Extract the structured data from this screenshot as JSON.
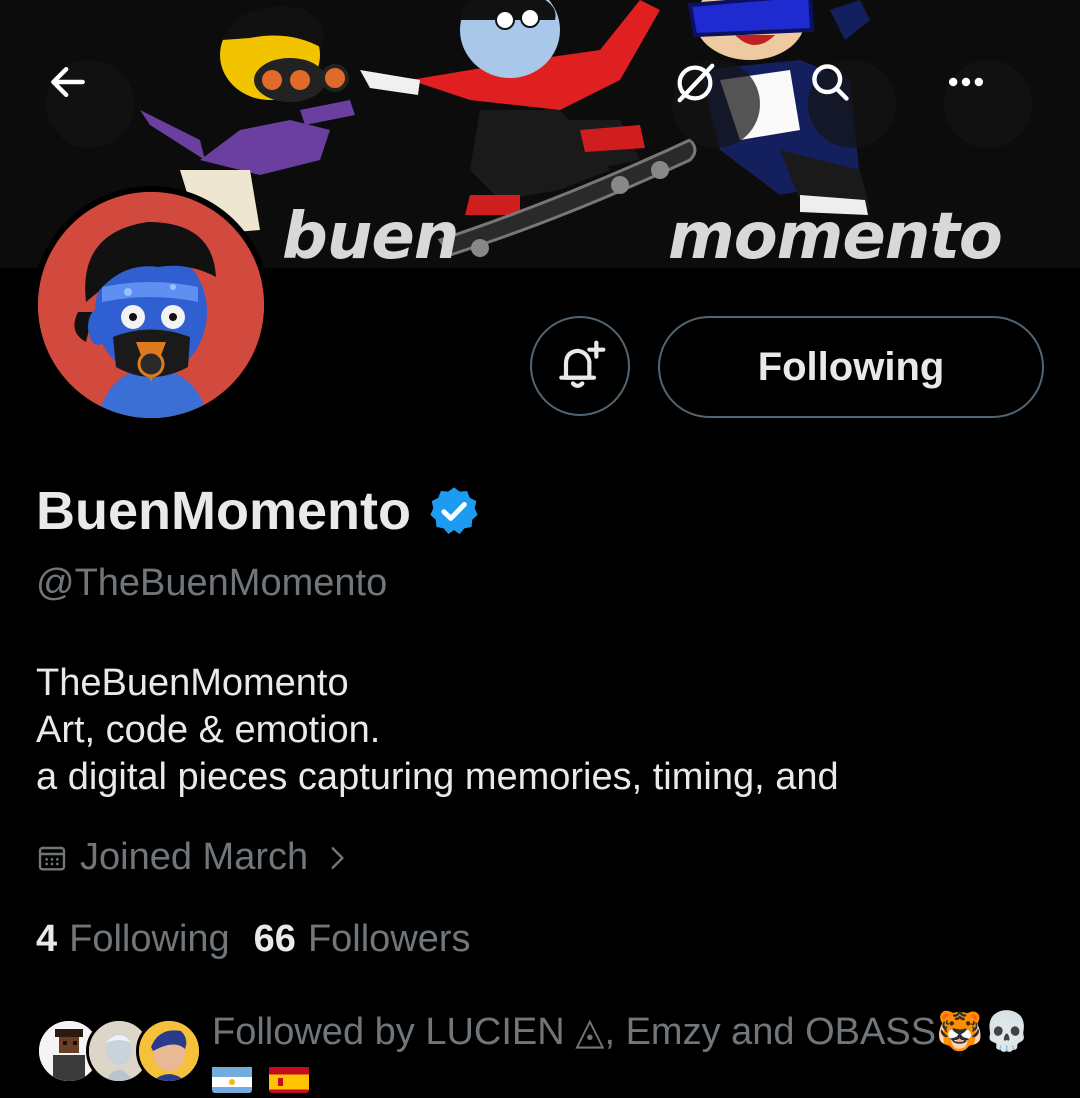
{
  "header": {
    "banner_words": [
      "buen",
      "momento"
    ],
    "buttons": {
      "back_icon": "arrow-left-icon",
      "grok_icon": "grok-icon",
      "search_icon": "search-icon",
      "more_icon": "more-icon"
    }
  },
  "profile": {
    "display_name": "BuenMomento",
    "verified": true,
    "handle": "@TheBuenMomento",
    "bio": [
      "TheBuenMomento",
      "Art, code & emotion.",
      "a digital pieces capturing memories, timing, and"
    ],
    "joined": "Joined March",
    "follow_button_label": "Following",
    "following_count": "4",
    "following_label": "Following",
    "followers_count": "66",
    "followers_label": "Followers",
    "followed_by_text": "Followed by LUCIEN ◬, Emzy and OBASS🐯💀"
  },
  "colors": {
    "background": "#000000",
    "text_primary": "#e7e9ea",
    "text_secondary": "#71767b",
    "border": "#536471",
    "verified_blue": "#1d9bf0",
    "avatar_bg": "#d24a3e"
  }
}
